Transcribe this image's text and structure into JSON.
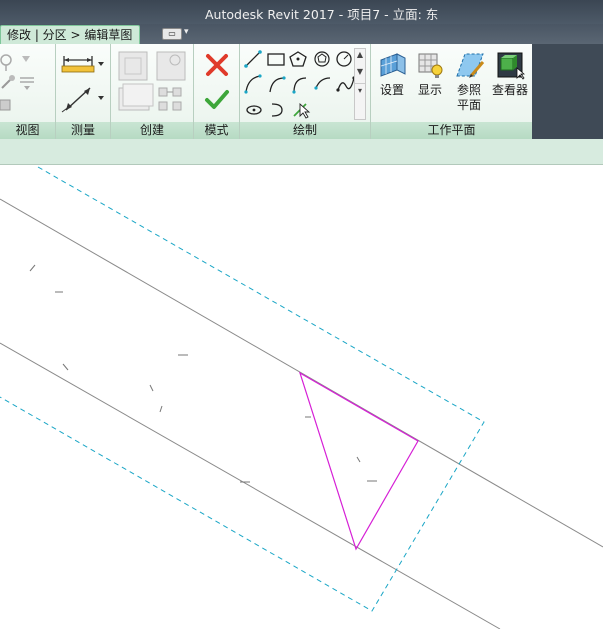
{
  "window": {
    "title": "Autodesk Revit 2017 -      项目7 - 立面: 东"
  },
  "ribbon_tabs": {
    "context_tab": "修改 | 分区 > 编辑草图"
  },
  "panels": {
    "view": {
      "label": "视图"
    },
    "measure": {
      "label": "测量"
    },
    "create": {
      "label": "创建"
    },
    "mode": {
      "label": "模式"
    },
    "draw": {
      "label": "绘制"
    },
    "workplane": {
      "label": "工作平面",
      "buttons": {
        "set": "设置",
        "show": "显示",
        "ref_plane": "参照\n平面",
        "viewer": "查看器"
      }
    }
  },
  "colors": {
    "sketch_line": "#d61fd6",
    "boundary_dash": "#1aa6c6",
    "ribbon_green": "#c9e5d3",
    "cancel_red": "#e03a2a",
    "finish_green": "#3da63a"
  },
  "icons": {
    "cancel": "x-icon",
    "finish": "check-icon",
    "line": "line-icon",
    "rectangle": "rectangle-icon",
    "polygon": "polygon-icon",
    "circle": "circle-icon",
    "arc": "arc-icon",
    "pick_lines": "pick-lines-icon"
  }
}
